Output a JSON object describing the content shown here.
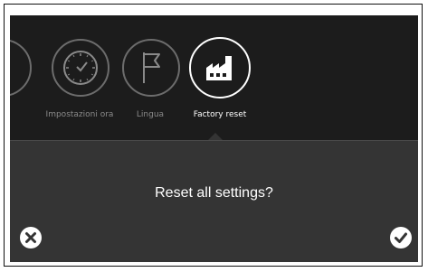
{
  "carousel": {
    "items": [
      {
        "icon": "partial-circle-icon",
        "label": "",
        "active": false
      },
      {
        "icon": "clock-icon",
        "label": "Impostazioni ora",
        "active": false
      },
      {
        "icon": "flag-icon",
        "label": "Lingua",
        "active": false
      },
      {
        "icon": "factory-icon",
        "label": "Factory reset",
        "active": true
      }
    ]
  },
  "dialog": {
    "prompt": "Reset all settings?",
    "cancel_icon": "close-icon",
    "confirm_icon": "checkmark-icon"
  },
  "colors": {
    "panel_top": "#1c1c1c",
    "panel_bottom": "#343434",
    "active_ring": "#ffffff",
    "inactive_ring": "#6c6c6c"
  }
}
